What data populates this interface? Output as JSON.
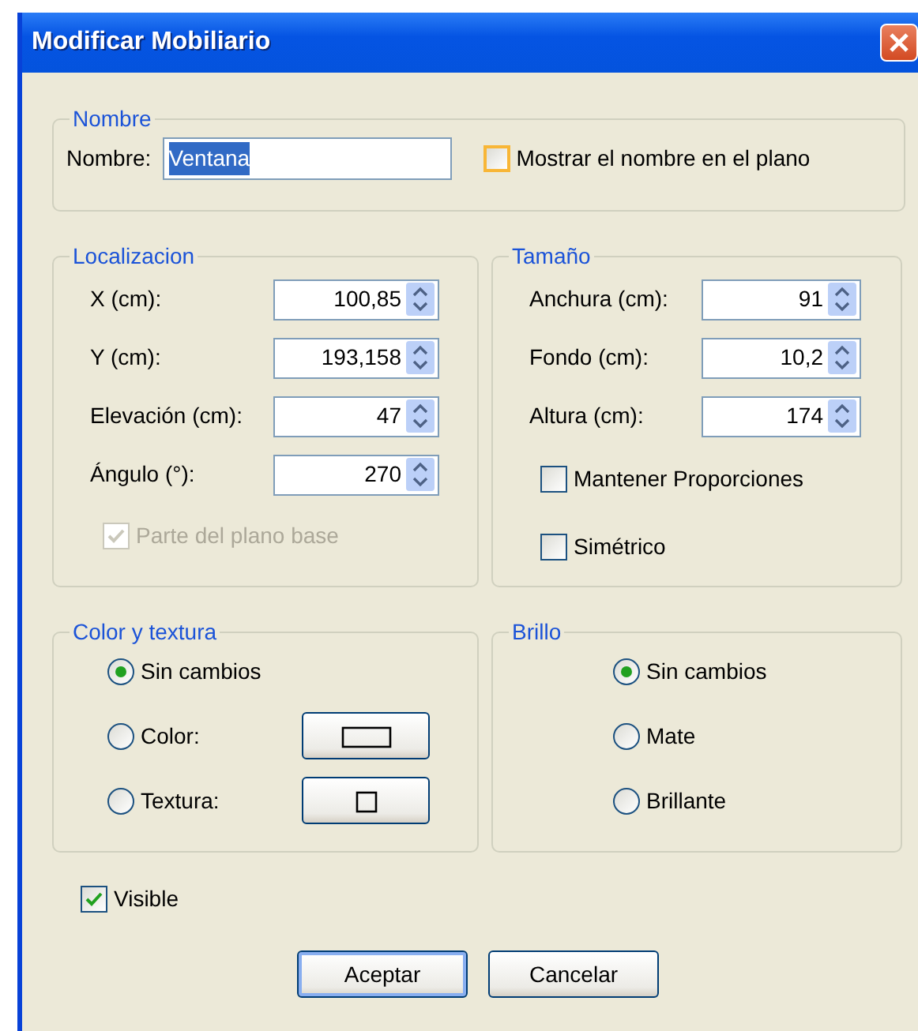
{
  "window": {
    "title": "Modificar Mobiliario"
  },
  "name_group": {
    "legend": "Nombre",
    "label": "Nombre:",
    "value": "Ventana",
    "text_selected": true,
    "show_name": {
      "label": "Mostrar el nombre en el plano",
      "checked": false,
      "hovered": true
    }
  },
  "location": {
    "legend": "Localizacion",
    "fields": [
      {
        "label": "X (cm):",
        "value": "100,85"
      },
      {
        "label": "Y (cm):",
        "value": "193,158"
      },
      {
        "label": "Elevación (cm):",
        "value": "47"
      },
      {
        "label": "Ángulo (°):",
        "value": "270"
      }
    ],
    "base_plan": {
      "label": "Parte del plano base",
      "checked": true,
      "disabled": true
    }
  },
  "size": {
    "legend": "Tamaño",
    "fields": [
      {
        "label": "Anchura (cm):",
        "value": "91"
      },
      {
        "label": "Fondo (cm):",
        "value": "10,2"
      },
      {
        "label": "Altura (cm):",
        "value": "174"
      }
    ],
    "checkboxes": [
      {
        "label": "Mantener Proporciones",
        "checked": false
      },
      {
        "label": "Simétrico",
        "checked": false
      }
    ]
  },
  "color": {
    "legend": "Color y textura",
    "options": [
      {
        "label": "Sin cambios",
        "selected": true,
        "kind": "plain"
      },
      {
        "label": "Color:",
        "selected": false,
        "kind": "color"
      },
      {
        "label": "Textura:",
        "selected": false,
        "kind": "texture"
      }
    ]
  },
  "shine": {
    "legend": "Brillo",
    "options": [
      {
        "label": "Sin cambios",
        "selected": true
      },
      {
        "label": "Mate",
        "selected": false
      },
      {
        "label": "Brillante",
        "selected": false
      }
    ]
  },
  "visible": {
    "label": "Visible",
    "checked": true
  },
  "buttons": [
    {
      "label": "Aceptar",
      "default": true
    },
    {
      "label": "Cancelar",
      "default": false
    }
  ]
}
